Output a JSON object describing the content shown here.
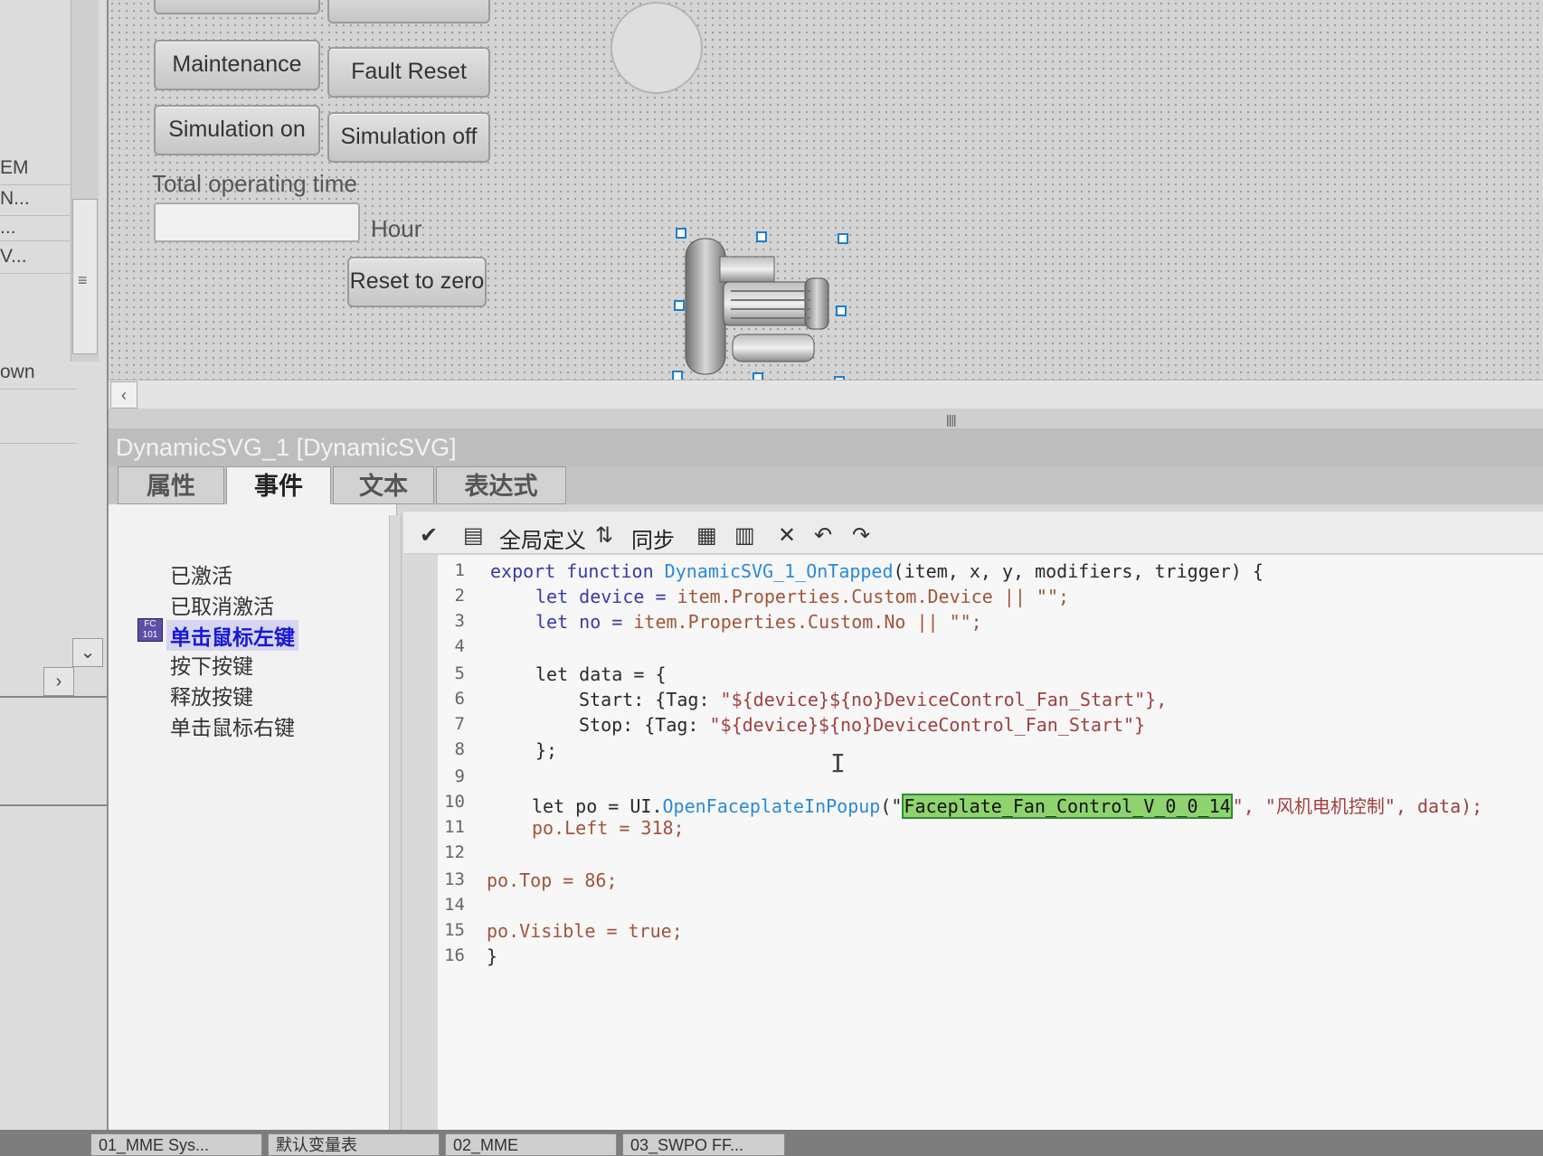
{
  "left_panel": {
    "rows": [
      "EM",
      "N...",
      "...",
      "V...",
      "own"
    ]
  },
  "canvas": {
    "buttons": {
      "maintenance": "Maintenance",
      "fault_reset": "Fault Reset",
      "simulation_on": "Simulation on",
      "simulation_off": "Simulation off",
      "reset_to_zero": "Reset to zero"
    },
    "total_time_label": "Total operating time",
    "total_time_value": "",
    "hour_unit": "Hour"
  },
  "panel": {
    "object_title": "DynamicSVG_1 [DynamicSVG]",
    "tabs": [
      "属性",
      "事件",
      "文本",
      "表达式"
    ],
    "active_tab": "事件",
    "events": [
      "已激活",
      "已取消激活",
      "单击鼠标左键",
      "按下按键",
      "释放按键",
      "单击鼠标右键"
    ],
    "selected_event": "单击鼠标左键",
    "toolbar": {
      "global_def_label": "全局定义",
      "sync_label": "同步"
    }
  },
  "editor": {
    "line_numbers": [
      "1",
      "2",
      "3",
      "4",
      "5",
      "6",
      "7",
      "8",
      "9",
      "10",
      "11",
      "12",
      "13",
      "14",
      "15",
      "16"
    ],
    "lines": {
      "l1_a": "export function ",
      "l1_fn": "DynamicSVG_1_OnTapped",
      "l1_b": "(item, x, y, modifiers, trigger) {",
      "l2_a": "let device = ",
      "l2_b": "item.Properties.Custom.Device || \"\";",
      "l3_a": "let no = ",
      "l3_b": "item.Properties.Custom.No || \"\";",
      "l5": "let data = {",
      "l6_a": "Start: {Tag: ",
      "l6_b": "\"${device}${no}DeviceControl_Fan_Start\"},",
      "l7_a": "Stop: {Tag: ",
      "l7_b": "\"${device}${no}DeviceControl_Fan_Start\"}",
      "l8": "};",
      "l10_a": "let po = UI.",
      "l10_fn": "OpenFaceplateInPopup",
      "l10_b": "(\"",
      "l10_hl": "Faceplate_Fan_Control_V_0_0_14",
      "l10_c": "\", \"风机电机控制\", data);",
      "l11": "po.Left = 318;",
      "l13": "po.Top = 86;",
      "l15": "po.Visible = true;",
      "l16": "}"
    }
  },
  "bottom_tabs": [
    "01_MME Sys...",
    "默认变量表",
    "02_MME",
    "03_SWPO FF..."
  ]
}
